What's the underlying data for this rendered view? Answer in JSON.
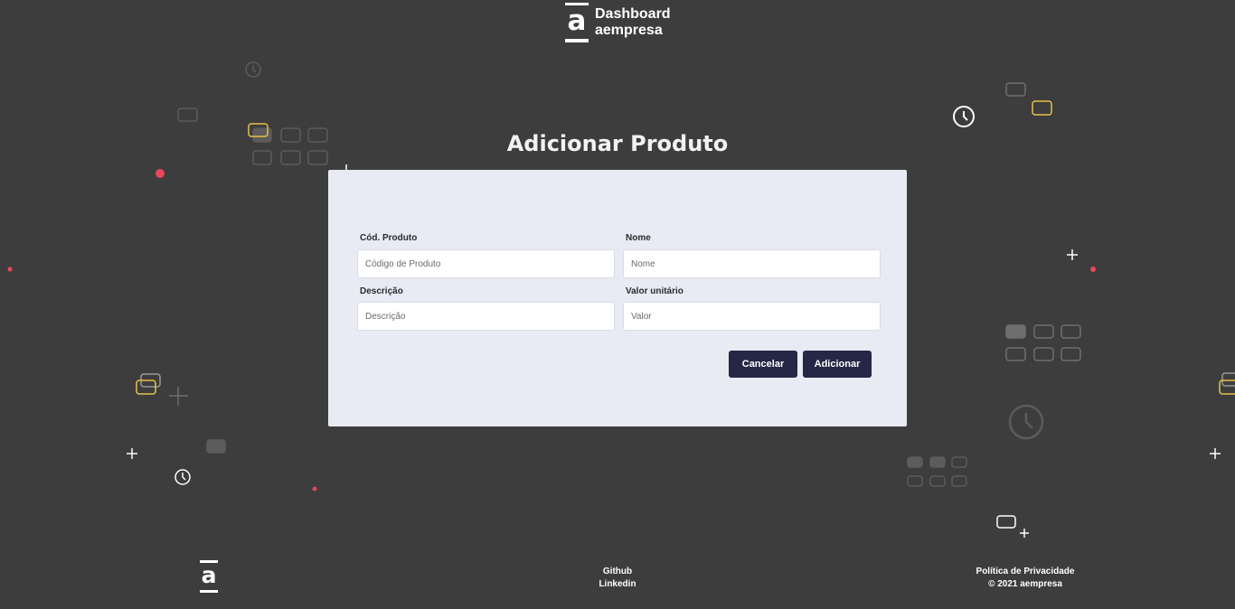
{
  "header": {
    "logo_glyph": "a",
    "brand_line1": "Dashboard",
    "brand_line2": "aempresa"
  },
  "page": {
    "title": "Adicionar Produto"
  },
  "form": {
    "code": {
      "label": "Cód. Produto",
      "placeholder": "Código de Produto",
      "value": ""
    },
    "name": {
      "label": "Nome",
      "placeholder": "Nome",
      "value": ""
    },
    "description": {
      "label": "Descrição",
      "placeholder": "Descrição",
      "value": ""
    },
    "price": {
      "label": "Valor unitário",
      "placeholder": "Valor",
      "value": ""
    },
    "cancel_label": "Cancelar",
    "submit_label": "Adicionar"
  },
  "footer": {
    "logo_glyph": "a",
    "github_label": "Github",
    "linkedin_label": "Linkedin",
    "privacy_label": "Política de Privacidade",
    "copyright": "© 2021 aempresa"
  },
  "colors": {
    "background": "#3d3d3d",
    "card": "#e8ebf4",
    "button": "#262647",
    "accent_yellow": "#e8c14a",
    "accent_red": "#e8485a"
  },
  "decorations": [
    "clock-icon",
    "card-outline-icon",
    "plus-icon",
    "dot"
  ]
}
